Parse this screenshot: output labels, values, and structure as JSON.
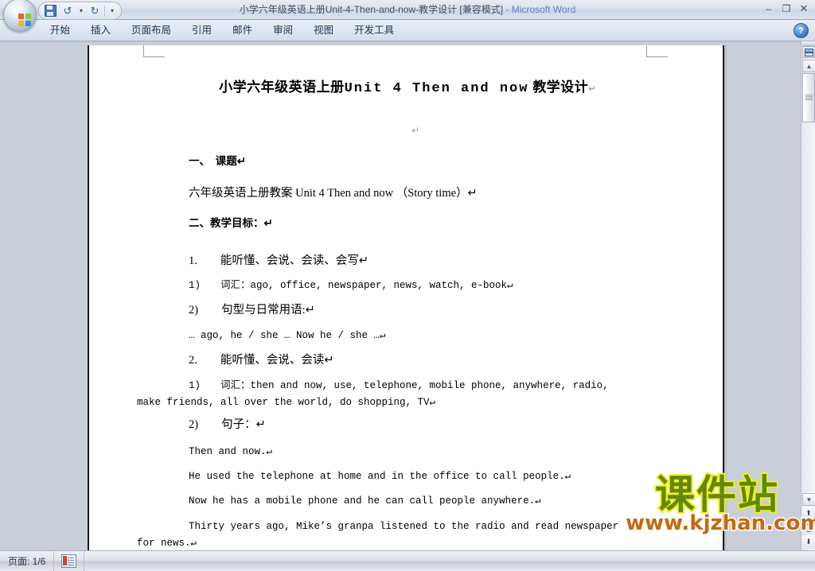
{
  "window": {
    "title_doc": "小学六年级英语上册Unit-4-Then-and-now-教学设计 [兼容模式]",
    "title_dash": "-",
    "title_app": "Microsoft Word",
    "minimize": "–",
    "restore": "❐",
    "close": "✕",
    "help": "?"
  },
  "quick_access": {
    "save_icon": "save-icon",
    "undo_icon": "undo-icon",
    "undo_caret": "▾",
    "redo_icon": "redo-icon",
    "customize_caret": "▾"
  },
  "ribbon": {
    "tabs": [
      {
        "label": "开始"
      },
      {
        "label": "插入"
      },
      {
        "label": "页面布局"
      },
      {
        "label": "引用"
      },
      {
        "label": "邮件"
      },
      {
        "label": "审阅"
      },
      {
        "label": "视图"
      },
      {
        "label": "开发工具"
      }
    ]
  },
  "document": {
    "title_cn_prefix": "小学六年级英语上册",
    "title_en": "Unit  4  Then  and  now",
    "title_cn_suffix": "教学设计",
    "pilcrow": "↵",
    "paragraphs": [
      {
        "id": "empty-mark",
        "text": "↵"
      },
      {
        "id": "heading-1",
        "text": "一、　课题↵"
      },
      {
        "id": "topic-line",
        "text": "六年级英语上册教案 Unit 4 Then and now  （Story time）↵"
      },
      {
        "id": "heading-2",
        "text": "二、教学目标：↵"
      },
      {
        "id": "obj-1",
        "text": "1.　　能听懂、会说、会读、会写↵"
      },
      {
        "id": "obj-1-1",
        "text": "1)　　词汇：ago, office, newspaper, news, watch, e-book↵"
      },
      {
        "id": "obj-1-2",
        "text": "2)　　句型与日常用语:↵"
      },
      {
        "id": "obj-1-2-ex",
        "text": "… ago, he / she …           Now he / she …↵"
      },
      {
        "id": "obj-2",
        "text": "2.　　能听懂、会说、会读↵"
      },
      {
        "id": "obj-2-1a",
        "text": "1)　　词汇：then and now, use, telephone, mobile phone, anywhere, radio,"
      },
      {
        "id": "obj-2-1b",
        "text": "make friends, all over the world,  do shopping,  TV↵"
      },
      {
        "id": "obj-2-2",
        "text": "2)　　句子：↵"
      },
      {
        "id": "sent-1",
        "text": "Then and now.↵"
      },
      {
        "id": "sent-2",
        "text": "He used the telephone at home and in the office to call people.↵"
      },
      {
        "id": "sent-3",
        "text": "Now he has a mobile phone and he can call people anywhere.↵"
      },
      {
        "id": "sent-4a",
        "text": "Thirty years ago, Mike’s granpa listened to the radio and read newspaper"
      },
      {
        "id": "sent-4b",
        "text": "for news.↵"
      }
    ]
  },
  "watermark": {
    "cn": "课件站",
    "url": "www.kjzhan.com",
    "color_cn": "#5f8a0c",
    "color_cn_stroke": "#f5ee1e",
    "color_url": "#c46a10"
  },
  "scrollbar": {
    "view_icon": "split-view-icon",
    "up_arrow": "▲",
    "down_arrow": "▼",
    "prev_page": "⬆",
    "select_object": "select-browse-object-icon",
    "next_page": "⬇"
  },
  "statusbar": {
    "page_label": "页面: 1/6",
    "doc_icon": "document-icon"
  }
}
